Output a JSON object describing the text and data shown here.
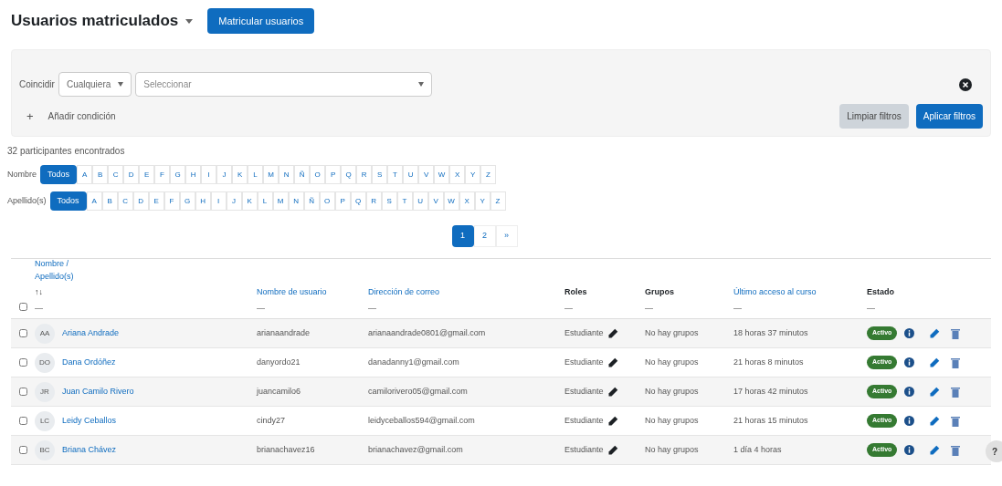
{
  "header": {
    "title": "Usuarios matriculados",
    "enrol_button": "Matricular usuarios"
  },
  "filter": {
    "match_label": "Coincidir",
    "match_value": "Cualquiera",
    "select_placeholder": "Seleccionar",
    "add_condition": "Añadir condición",
    "add_icon": "+",
    "clear_button": "Limpiar filtros",
    "apply_button": "Aplicar filtros"
  },
  "count": "32 participantes encontrados",
  "initials_bars": [
    {
      "label": "Nombre",
      "items": [
        {
          "label": "Todos",
          "selected": true
        },
        {
          "label": "A",
          "selected": false
        },
        {
          "label": "B",
          "selected": false
        },
        {
          "label": "C",
          "selected": false
        },
        {
          "label": "D",
          "selected": false
        },
        {
          "label": "E",
          "selected": false
        },
        {
          "label": "F",
          "selected": false
        },
        {
          "label": "G",
          "selected": false
        },
        {
          "label": "H",
          "selected": false
        },
        {
          "label": "I",
          "selected": false
        },
        {
          "label": "J",
          "selected": false
        },
        {
          "label": "K",
          "selected": false
        },
        {
          "label": "L",
          "selected": false
        },
        {
          "label": "M",
          "selected": false
        },
        {
          "label": "N",
          "selected": false
        },
        {
          "label": "Ñ",
          "selected": false
        },
        {
          "label": "O",
          "selected": false
        },
        {
          "label": "P",
          "selected": false
        },
        {
          "label": "Q",
          "selected": false
        },
        {
          "label": "R",
          "selected": false
        },
        {
          "label": "S",
          "selected": false
        },
        {
          "label": "T",
          "selected": false
        },
        {
          "label": "U",
          "selected": false
        },
        {
          "label": "V",
          "selected": false
        },
        {
          "label": "W",
          "selected": false
        },
        {
          "label": "X",
          "selected": false
        },
        {
          "label": "Y",
          "selected": false
        },
        {
          "label": "Z",
          "selected": false
        }
      ]
    },
    {
      "label": "Apellido(s)",
      "items": [
        {
          "label": "Todos",
          "selected": true
        },
        {
          "label": "A",
          "selected": false
        },
        {
          "label": "B",
          "selected": false
        },
        {
          "label": "C",
          "selected": false
        },
        {
          "label": "D",
          "selected": false
        },
        {
          "label": "E",
          "selected": false
        },
        {
          "label": "F",
          "selected": false
        },
        {
          "label": "G",
          "selected": false
        },
        {
          "label": "H",
          "selected": false
        },
        {
          "label": "I",
          "selected": false
        },
        {
          "label": "J",
          "selected": false
        },
        {
          "label": "K",
          "selected": false
        },
        {
          "label": "L",
          "selected": false
        },
        {
          "label": "M",
          "selected": false
        },
        {
          "label": "N",
          "selected": false
        },
        {
          "label": "Ñ",
          "selected": false
        },
        {
          "label": "O",
          "selected": false
        },
        {
          "label": "P",
          "selected": false
        },
        {
          "label": "Q",
          "selected": false
        },
        {
          "label": "R",
          "selected": false
        },
        {
          "label": "S",
          "selected": false
        },
        {
          "label": "T",
          "selected": false
        },
        {
          "label": "U",
          "selected": false
        },
        {
          "label": "V",
          "selected": false
        },
        {
          "label": "W",
          "selected": false
        },
        {
          "label": "X",
          "selected": false
        },
        {
          "label": "Y",
          "selected": false
        },
        {
          "label": "Z",
          "selected": false
        }
      ]
    }
  ],
  "pagination": [
    {
      "label": "1",
      "selected": true
    },
    {
      "label": "2",
      "selected": false
    },
    {
      "label": "»",
      "selected": false
    }
  ],
  "table": {
    "select_all_checked": false,
    "columns": [
      {
        "label": "Nombre / Apellido(s)",
        "sortable": true,
        "sort_mark": "↑↓",
        "collapse": "—"
      },
      {
        "label": "Nombre de usuario",
        "sortable": true,
        "collapse": "—"
      },
      {
        "label": "Dirección de correo",
        "sortable": true,
        "collapse": "—"
      },
      {
        "label": "Roles",
        "sortable": false,
        "collapse": "—"
      },
      {
        "label": "Grupos",
        "sortable": false,
        "collapse": "—"
      },
      {
        "label": "Último acceso al curso",
        "sortable": true,
        "collapse": "—"
      },
      {
        "label": "Estado",
        "sortable": false,
        "collapse": "—"
      }
    ],
    "rows": [
      {
        "checked": false,
        "initials": "AA",
        "name": "Ariana Andrade",
        "username": "arianaandrade",
        "email": "arianaandrade0801@gmail.com",
        "role": "Estudiante",
        "groups": "No hay grupos",
        "last_access": "18 horas 37 minutos",
        "status": "Activo"
      },
      {
        "checked": false,
        "initials": "DO",
        "name": "Dana Ordóñez",
        "username": "danyordo21",
        "email": "danadanny1@gmail.com",
        "role": "Estudiante",
        "groups": "No hay grupos",
        "last_access": "21 horas 8 minutos",
        "status": "Activo"
      },
      {
        "checked": false,
        "initials": "JR",
        "name": "Juan Camilo Rivero",
        "username": "juancamilo6",
        "email": "camilorivero05@gmail.com",
        "role": "Estudiante",
        "groups": "No hay grupos",
        "last_access": "17 horas 42 minutos",
        "status": "Activo"
      },
      {
        "checked": false,
        "initials": "LC",
        "name": "Leidy Ceballos",
        "username": "cindy27",
        "email": "leidyceballos594@gmail.com",
        "role": "Estudiante",
        "groups": "No hay grupos",
        "last_access": "21 horas 15 minutos",
        "status": "Activo"
      },
      {
        "checked": false,
        "initials": "BC",
        "name": "Briana Chávez",
        "username": "brianachavez16",
        "email": "brianachavez@gmail.com",
        "role": "Estudiante",
        "groups": "No hay grupos",
        "last_access": "1 día 4 horas",
        "status": "Activo"
      }
    ]
  },
  "help_button": "?"
}
